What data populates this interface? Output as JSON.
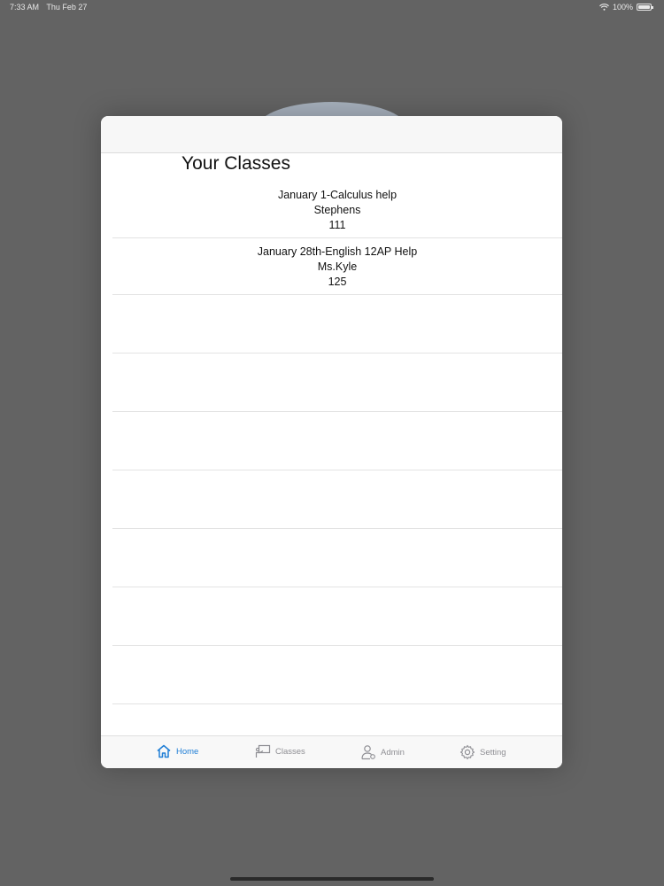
{
  "status_bar": {
    "time": "7:33 AM",
    "date": "Thu Feb 27",
    "battery": "100%"
  },
  "page_title": "Your Classes",
  "classes": [
    {
      "title": "January 1-Calculus help",
      "teacher": "Stephens",
      "room": "111"
    },
    {
      "title": "January 28th-English 12AP Help",
      "teacher": "Ms.Kyle",
      "room": "125"
    }
  ],
  "tabs": [
    {
      "label": "Home",
      "icon": "home-icon",
      "active": true
    },
    {
      "label": "Classes",
      "icon": "classroom-icon",
      "active": false
    },
    {
      "label": "Admin",
      "icon": "admin-icon",
      "active": false
    },
    {
      "label": "Setting",
      "icon": "gear-icon",
      "active": false
    }
  ],
  "colors": {
    "accent": "#1f7ed6",
    "inactive_tab": "#8e8e93"
  }
}
